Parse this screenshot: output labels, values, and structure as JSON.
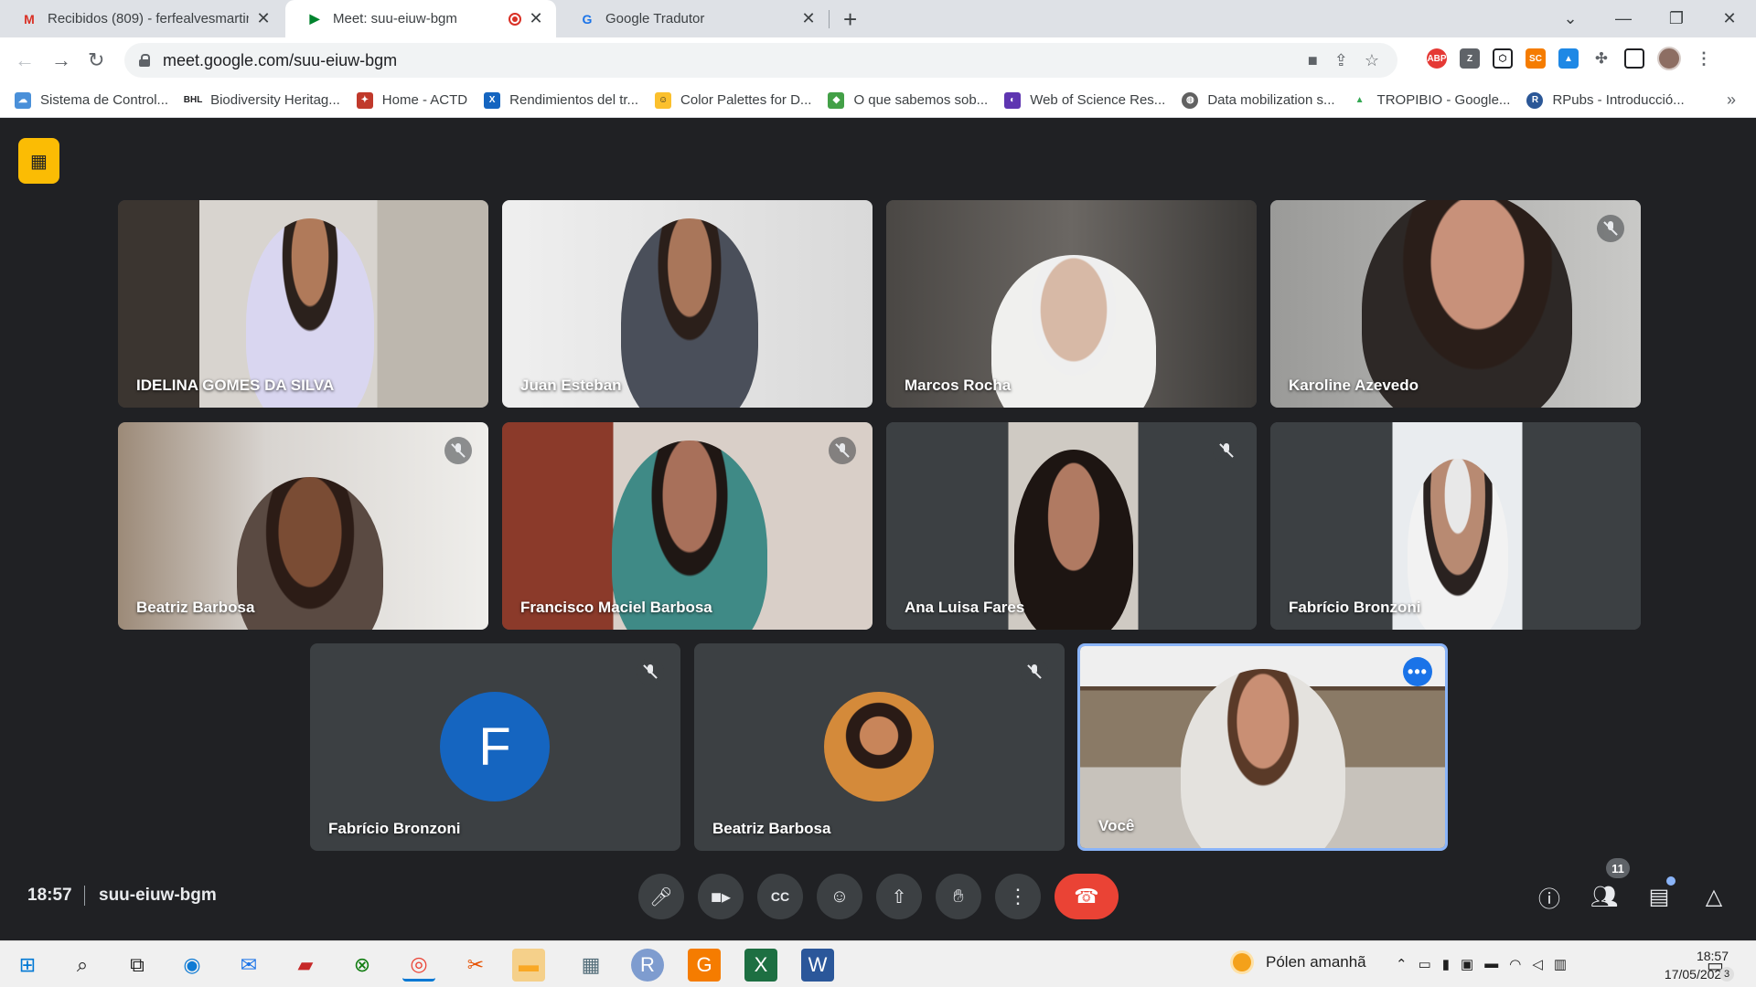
{
  "browser": {
    "tabs": [
      {
        "title": "Recibidos (809) - ferfealvesmartin",
        "favicon": "gmail-icon"
      },
      {
        "title": "Meet: suu-eiuw-bgm",
        "favicon": "meet-icon"
      },
      {
        "title": "Google Tradutor",
        "favicon": "translate-icon"
      }
    ],
    "url": "meet.google.com/suu-eiuw-bgm",
    "bookmarks": [
      "Sistema de Control...",
      "Biodiversity Heritag...",
      "Home - ACTD",
      "Rendimientos del tr...",
      "Color Palettes for D...",
      "O que sabemos sob...",
      "Web of Science Res...",
      "Data mobilization s...",
      "TROPIBIO - Google...",
      "RPubs - Introducció..."
    ]
  },
  "meet": {
    "participants": [
      {
        "name": "IDELINA GOMES DA SILVA",
        "muted": false
      },
      {
        "name": "Juan Esteban",
        "muted": false
      },
      {
        "name": "Marcos Rocha",
        "muted": false
      },
      {
        "name": "Karoline Azevedo",
        "muted": true
      },
      {
        "name": "Beatriz Barbosa",
        "muted": true
      },
      {
        "name": "Francisco Maciel Barbosa",
        "muted": true
      },
      {
        "name": "Ana Luisa Fares",
        "muted": true
      },
      {
        "name": "Fabrício Bronzoni",
        "muted": false
      },
      {
        "name": "Fabrício Bronzoni",
        "muted": true,
        "avatar_letter": "F"
      },
      {
        "name": "Beatriz Barbosa",
        "muted": true
      },
      {
        "name": "Você",
        "muted": false
      }
    ],
    "time": "18:57",
    "meeting_code": "suu-eiuw-bgm",
    "people_count": "11",
    "accent": "#1a73e8",
    "hangup_color": "#ea4335"
  },
  "taskbar": {
    "weather_text": "Pólen amanhã",
    "clock_time": "18:57",
    "clock_date": "17/05/2023",
    "notification_count": "3"
  }
}
